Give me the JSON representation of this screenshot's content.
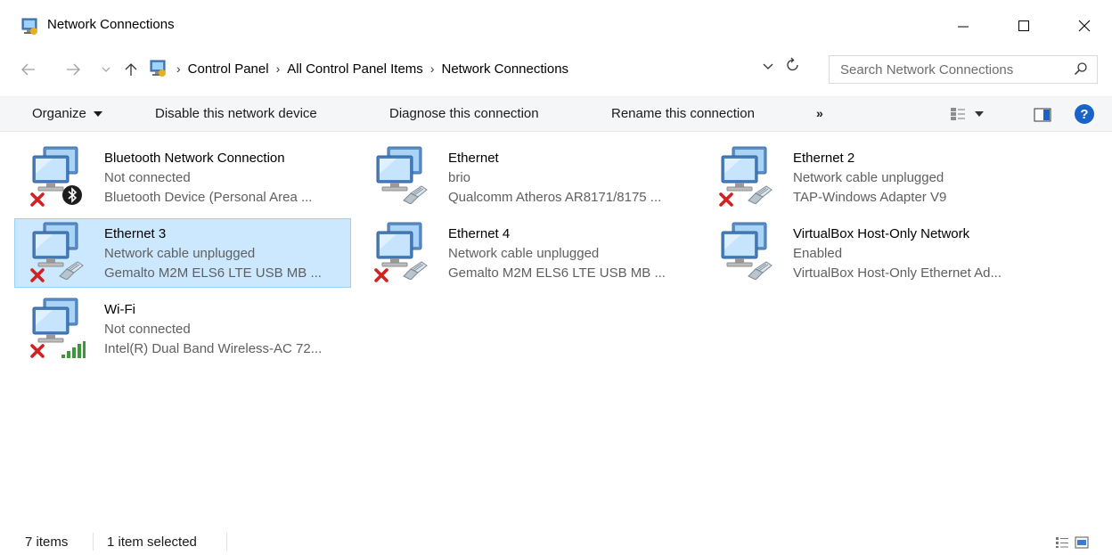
{
  "window": {
    "title": "Network Connections"
  },
  "address": {
    "crumbs": [
      "Control Panel",
      "All Control Panel Items",
      "Network Connections"
    ],
    "search_placeholder": "Search Network Connections"
  },
  "toolbar": {
    "organize": "Organize",
    "disable": "Disable this network device",
    "diagnose": "Diagnose this connection",
    "rename": "Rename this connection",
    "more": "»"
  },
  "connections": [
    {
      "name": "Bluetooth Network Connection",
      "status": "Not connected",
      "device": "Bluetooth Device (Personal Area ...",
      "badge": "bluetooth-icon",
      "error": true
    },
    {
      "name": "Ethernet",
      "status": "brio",
      "device": "Qualcomm Atheros AR8171/8175 ...",
      "badge": "network-cable-icon",
      "error": false
    },
    {
      "name": "Ethernet 2",
      "status": "Network cable unplugged",
      "device": "TAP-Windows Adapter V9",
      "badge": "network-cable-icon",
      "error": true
    },
    {
      "name": "Ethernet 3",
      "status": "Network cable unplugged",
      "device": "Gemalto M2M ELS6 LTE USB MB ...",
      "badge": "network-cable-icon",
      "error": true,
      "selected": true
    },
    {
      "name": "Ethernet 4",
      "status": "Network cable unplugged",
      "device": "Gemalto M2M ELS6 LTE USB MB ...",
      "badge": "network-cable-icon",
      "error": true
    },
    {
      "name": "VirtualBox Host-Only Network",
      "status": "Enabled",
      "device": "VirtualBox Host-Only Ethernet Ad...",
      "badge": "network-cable-icon",
      "error": false
    },
    {
      "name": "Wi-Fi",
      "status": "Not connected",
      "device": "Intel(R) Dual Band Wireless-AC 72...",
      "badge": "wifi-signal-icon",
      "error": true
    }
  ],
  "statusbar": {
    "count": "7 items",
    "selection": "1 item selected"
  },
  "colors": {
    "selection_bg": "#cce8ff",
    "selection_border": "#99d1ff",
    "help_blue": "#1a63c8",
    "error_red": "#d42020"
  }
}
